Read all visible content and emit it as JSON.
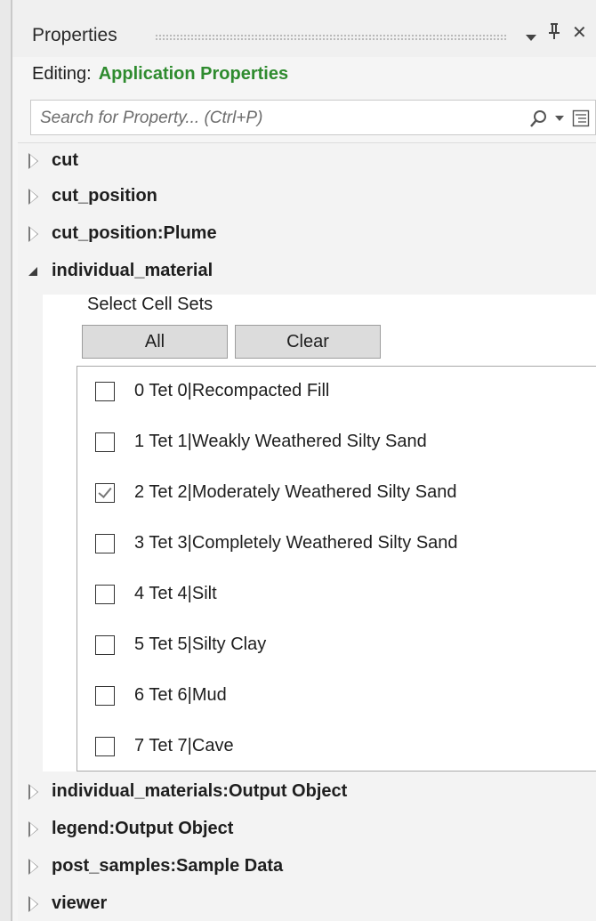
{
  "titlebar": {
    "title": "Properties",
    "icons": [
      "chevron-down-icon",
      "pin-icon",
      "close-icon"
    ],
    "close_glyph": "✕",
    "pin_glyph": "ᵖ"
  },
  "editing": {
    "label": "Editing:",
    "value": "Application Properties"
  },
  "search": {
    "placeholder": "Search for Property... (Ctrl+P)"
  },
  "tree": {
    "top_items": [
      {
        "label": "cut",
        "expanded": false
      },
      {
        "label": "cut_position",
        "expanded": false
      },
      {
        "label": "cut_position:Plume",
        "expanded": false
      },
      {
        "label": "individual_material",
        "expanded": true
      }
    ],
    "expanded_section": {
      "title": "Select Cell Sets",
      "buttons": {
        "all": "All",
        "clear": "Clear"
      },
      "cell_sets": [
        {
          "label": "0 Tet 0|Recompacted Fill",
          "checked": false
        },
        {
          "label": "1 Tet 1|Weakly Weathered Silty Sand",
          "checked": false
        },
        {
          "label": "2 Tet 2|Moderately Weathered Silty Sand",
          "checked": true
        },
        {
          "label": "3 Tet 3|Completely Weathered Silty Sand",
          "checked": false
        },
        {
          "label": "4 Tet 4|Silt",
          "checked": false
        },
        {
          "label": "5 Tet 5|Silty Clay",
          "checked": false
        },
        {
          "label": "6 Tet 6|Mud",
          "checked": false
        },
        {
          "label": "7 Tet 7|Cave",
          "checked": false
        }
      ]
    },
    "bottom_items": [
      {
        "label": "individual_materials:Output Object",
        "expanded": false
      },
      {
        "label": "legend:Output Object",
        "expanded": false
      },
      {
        "label": "post_samples:Sample Data",
        "expanded": false
      },
      {
        "label": "viewer",
        "expanded": false
      }
    ]
  },
  "colors": {
    "accent_green": "#2e8b2e",
    "panel_bg": "#f5f5f5"
  }
}
